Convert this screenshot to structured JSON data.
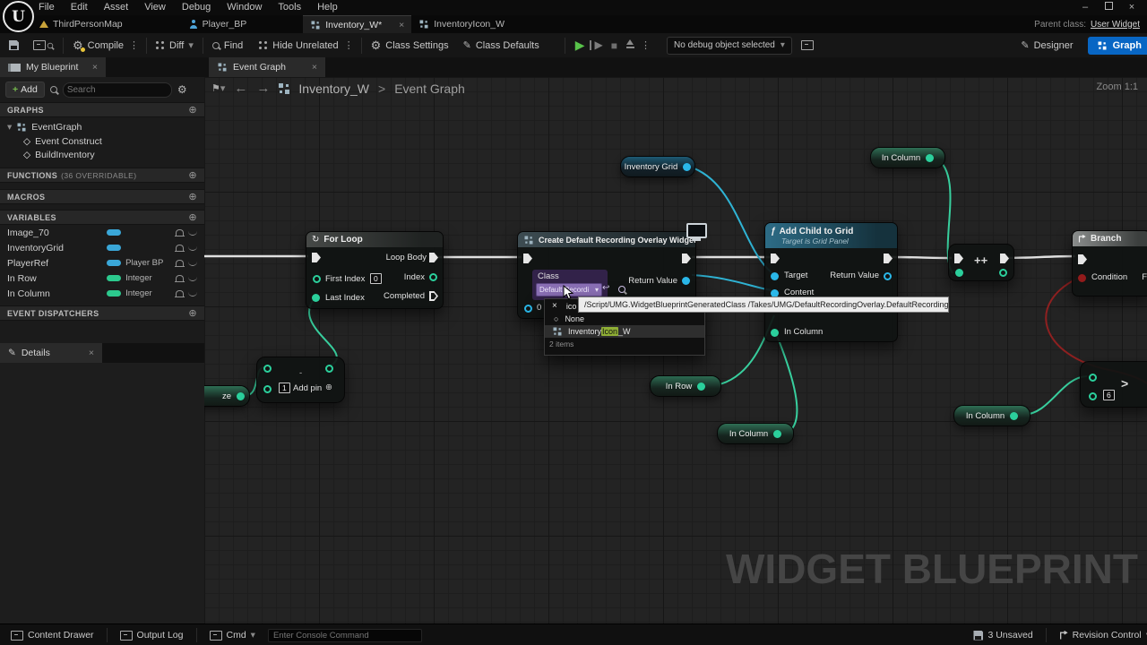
{
  "titlebar": {
    "menus": [
      "File",
      "Edit",
      "Asset",
      "View",
      "Debug",
      "Window",
      "Tools",
      "Help"
    ]
  },
  "window_controls": {
    "minimize": "–",
    "close": "×"
  },
  "tabs": {
    "map": "ThirdPersonMap",
    "player": "Player_BP",
    "inventory": "Inventory_W*",
    "inventory_icon": "InventoryIcon_W",
    "parent_class_label": "Parent class:",
    "parent_class_value": "User Widget"
  },
  "toolbar": {
    "compile": "Compile",
    "diff": "Diff",
    "find": "Find",
    "hide_unrelated": "Hide Unrelated",
    "class_settings": "Class Settings",
    "class_defaults": "Class Defaults",
    "debug": "No debug object selected",
    "designer": "Designer",
    "graph": "Graph"
  },
  "sidebar": {
    "tab": "My Blueprint",
    "add_label": "Add",
    "search_placeholder": "Search",
    "graphs_header": "GRAPHS",
    "event_graph": "EventGraph",
    "event_construct": "Event Construct",
    "build_inventory": "BuildInventory",
    "functions_header": "FUNCTIONS",
    "functions_note": "(36 OVERRIDABLE)",
    "macros_header": "MACROS",
    "variables_header": "VARIABLES",
    "variables": [
      {
        "name": "Image_70",
        "type": "",
        "color": "#3aa7d8"
      },
      {
        "name": "InventoryGrid",
        "type": "",
        "color": "#3aa7d8"
      },
      {
        "name": "PlayerRef",
        "type": "Player BP",
        "color": "#3aa7d8"
      },
      {
        "name": "In Row",
        "type": "Integer",
        "color": "#2cc98d"
      },
      {
        "name": "In Column",
        "type": "Integer",
        "color": "#2cc98d"
      }
    ],
    "dispatchers_header": "EVENT DISPATCHERS",
    "details_tab": "Details"
  },
  "graph": {
    "tab": "Event Graph",
    "breadcrumb_root": "Inventory_W",
    "breadcrumb_sep": ">",
    "breadcrumb_leaf": "Event Graph",
    "zoom_label": "Zoom 1:1",
    "watermark": "WIDGET BLUEPRINT"
  },
  "nodes": {
    "inventory_grid_getter": "Inventory Grid",
    "in_column_top": "In Column",
    "in_row_getter": "In Row",
    "in_column_mid": "In Column",
    "in_column_right": "In Column",
    "size_getter": "ze",
    "for_loop": {
      "title": "For Loop",
      "loop_body": "Loop Body",
      "first_index": "First Index",
      "first_index_value": "0",
      "index": "Index",
      "last_index": "Last Index",
      "completed": "Completed"
    },
    "subtract": {
      "op": "-",
      "value": "1",
      "add_pin": "Add pin"
    },
    "create_widget": {
      "title": "Create Default Recording Overlay Widget",
      "class_label": "Class",
      "class_value": "Default Recordi",
      "return_value": "Return Value",
      "owner_pin": "0"
    },
    "class_picker": {
      "search": "ico",
      "none": "None",
      "option_pre": "Inventory",
      "option_match": "Icon",
      "option_post": "_W",
      "footer": "2 items"
    },
    "tooltip": "/Script/UMG.WidgetBlueprintGeneratedClass /Takes/UMG/DefaultRecordingOverlay.DefaultRecordingOverlay_C",
    "add_child": {
      "title": "Add Child to Grid",
      "subtitle": "Target is Grid Panel",
      "target": "Target",
      "return_value": "Return Value",
      "content": "Content",
      "in_column": "In Column"
    },
    "increment": "++",
    "branch": {
      "title": "Branch",
      "condition": "Condition",
      "false_label": "F"
    },
    "greater": {
      "op": ">",
      "value": "6"
    }
  },
  "statusbar": {
    "content_drawer": "Content Drawer",
    "output_log": "Output Log",
    "cmd": "Cmd",
    "console_placeholder": "Enter Console Command",
    "unsaved": "3 Unsaved",
    "revision": "Revision Control"
  },
  "icons": {
    "close": "×",
    "chevron": "▾",
    "circle_plus": "⊕",
    "dots": "⋮",
    "gear": "⚙",
    "back": "←",
    "forward": "→",
    "flag": "⚑",
    "pencil": "✎",
    "diamond": "◇",
    "loop": "↻",
    "fn": "ƒ",
    "undo": "↩",
    "play": "▶",
    "stop": "■",
    "none_circle": "○",
    "caret": "▾"
  },
  "colors": {
    "accent_blue": "#0866c4",
    "pin_int": "#2bd09c",
    "pin_object": "#2ab7e8",
    "pin_bool": "#921b1b",
    "exec": "#e6e6e6"
  }
}
